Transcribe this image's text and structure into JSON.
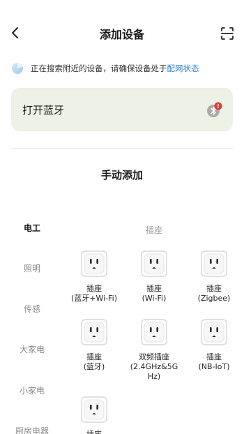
{
  "header": {
    "title": "添加设备",
    "back_icon": "back-arrow-icon",
    "scan_icon": "scan-icon"
  },
  "search_hint": {
    "text": "正在搜索附近的设备，请确保设备处于",
    "link": "配网状态",
    "link_color": "#2a7fd4"
  },
  "bluetooth_card": {
    "label": "打开蓝牙",
    "icon": "bluetooth-off-icon",
    "badge": "!",
    "badge_color": "#e53935",
    "background": "#edf1e6"
  },
  "manual": {
    "title": "手动添加",
    "categories": [
      {
        "label": "电工",
        "active": true
      },
      {
        "label": "照明",
        "active": false
      },
      {
        "label": "传感",
        "active": false
      },
      {
        "label": "大家电",
        "active": false
      },
      {
        "label": "小家电",
        "active": false
      },
      {
        "label": "厨房电器",
        "active": false
      }
    ],
    "section": "插座",
    "devices": [
      {
        "line1": "插座",
        "line2": "(蓝牙+Wi-Fi)"
      },
      {
        "line1": "插座",
        "line2": "(Wi-Fi)"
      },
      {
        "line1": "插座",
        "line2": "(Zigbee)"
      },
      {
        "line1": "插座",
        "line2": "(蓝牙)"
      },
      {
        "line1": "双频插座",
        "line2": "(2.4GHz&5G",
        "line3": "Hz)"
      },
      {
        "line1": "插座",
        "line2": "(NB-IoT)"
      },
      {
        "line1": "插座"
      }
    ]
  }
}
